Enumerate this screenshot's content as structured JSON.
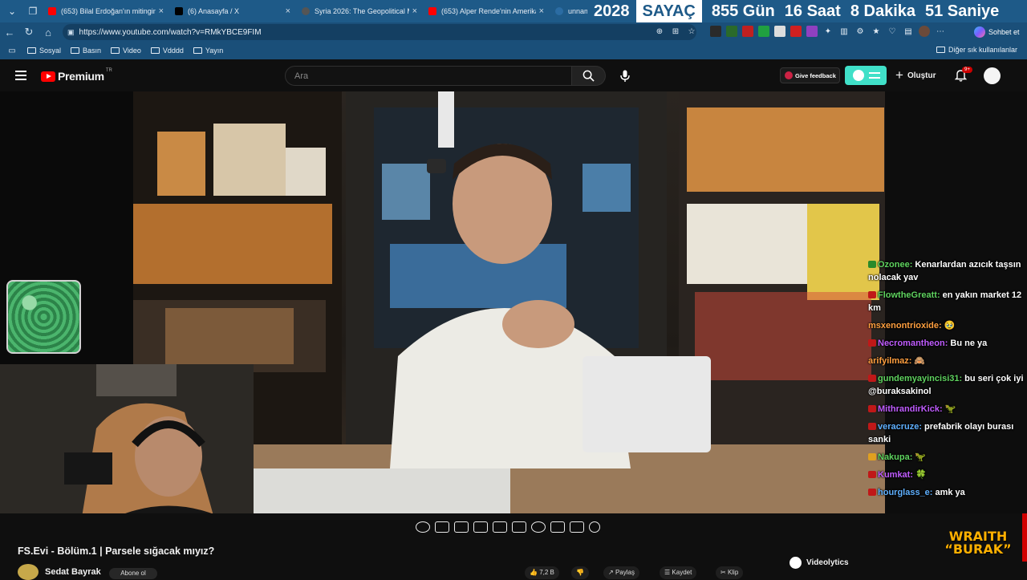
{
  "browser": {
    "tabs": [
      {
        "label": "(653) Bilal Erdoğan'ın mitingine k",
        "fav_color": "#ff0000"
      },
      {
        "label": "(6) Anasayfa / X",
        "fav_color": "#000000"
      },
      {
        "label": "Syria 2026: The Geopolitical Map",
        "fav_color": "#555555"
      },
      {
        "label": "(653) Alper Rende'nin Amerikan k",
        "fav_color": "#ff0000"
      },
      {
        "label": "unnamed (",
        "fav_color": "#2b6ca3"
      }
    ],
    "close_glyph": "×",
    "url": "https://www.youtube.com/watch?v=RMkYBCE9FIM",
    "chat_label": "Sohbet et",
    "bookmarks": [
      "Sosyal",
      "Basın",
      "Video",
      "Vdddd",
      "Yayın"
    ],
    "bookmarks_other": "Diğer sık kullanılanlar"
  },
  "counter": {
    "year": "2028",
    "label": "SAYAÇ",
    "days": "855 Gün",
    "hours": "16 Saat",
    "minutes": "8 Dakika",
    "seconds": "51 Saniye"
  },
  "youtube": {
    "logo_text": "Premium",
    "logo_region": "TR",
    "search_placeholder": "Ara",
    "feedback_label": "Give feedback",
    "create_label": "Oluştur",
    "notif_count": "9+"
  },
  "chat": [
    {
      "user": "Ozonee:",
      "color": "#5fd35f",
      "badge": "#2a8a2a",
      "text": "Kenarlardan azıcık taşsın nolacak yav"
    },
    {
      "user": "FlowtheGreatt:",
      "color": "#5fd35f",
      "badge": "#c01818",
      "text": "en yakın market 12 km"
    },
    {
      "user": "msxenontrioxide:",
      "color": "#ff9f3f",
      "badge": "",
      "text": "🥹"
    },
    {
      "user": "Necromantheon:",
      "color": "#c05cff",
      "badge": "#c01818",
      "text": "Bu ne ya"
    },
    {
      "user": "arifyilmaz:",
      "color": "#ff9f3f",
      "badge": "",
      "text": "🙈"
    },
    {
      "user": "gundemyayincisi31:",
      "color": "#5fd35f",
      "badge": "#c01818",
      "text": "bu seri çok iyi @buraksakinol"
    },
    {
      "user": "MithrandirKick:",
      "color": "#c05cff",
      "badge": "#c01818",
      "text": "🦖"
    },
    {
      "user": "veracruze:",
      "color": "#5fb0ff",
      "badge": "#c01818",
      "text": "prefabrik olayı burası sanki"
    },
    {
      "user": "Nakupa:",
      "color": "#5fd35f",
      "badge": "#e0a020",
      "text": "🦖"
    },
    {
      "user": "Kumkat:",
      "color": "#c05cff",
      "badge": "#c01818",
      "text": "🍀"
    },
    {
      "user": "hourglass_e:",
      "color": "#5fb0ff",
      "badge": "#c01818",
      "text": "amk ya"
    }
  ],
  "video": {
    "title": "FS.Evi - Bölüm.1 | Parsele sığacak mıyız?",
    "channel": "Sedat Bayrak",
    "subscribe": "Abone ol",
    "likes": "7,2 B",
    "share": "Paylaş",
    "save": "Kaydet",
    "clip": "Klip"
  },
  "overlay": {
    "videolytics": "Videolytics",
    "wraith_line1": "WRAITH",
    "wraith_line2": "“BURAK”"
  }
}
